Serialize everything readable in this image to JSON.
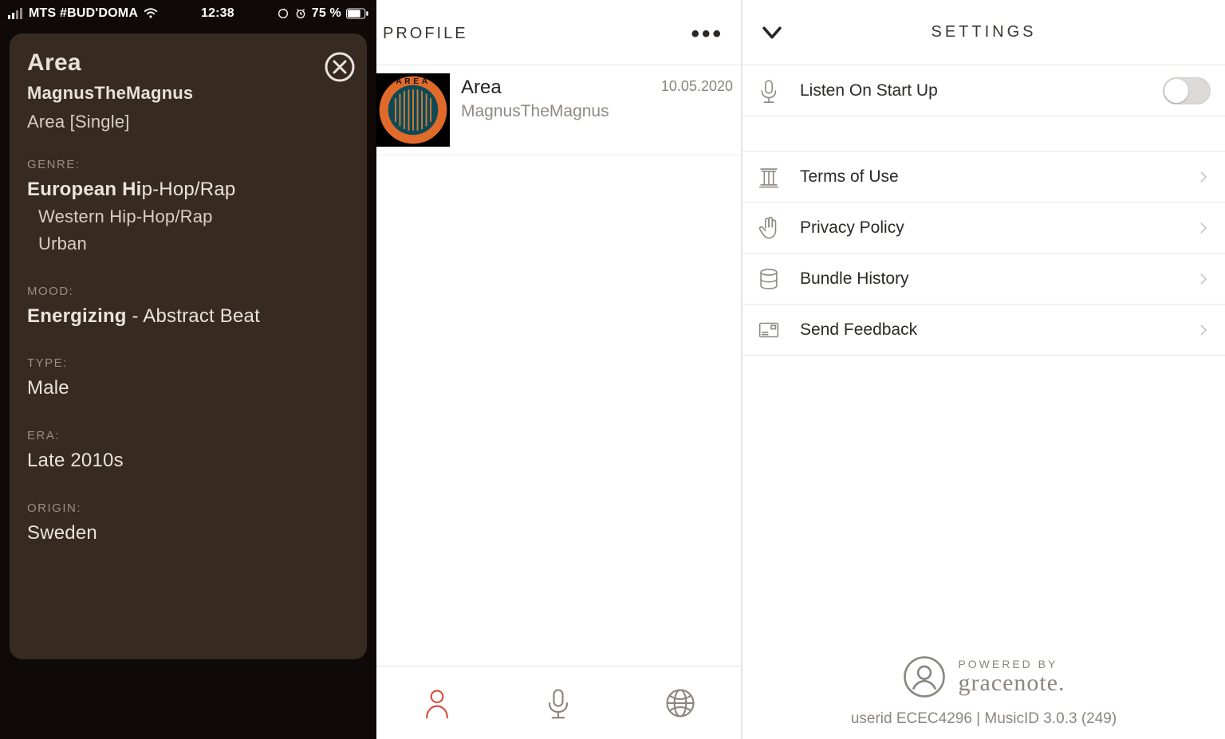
{
  "statusbar": {
    "carrier": "MTS #BUD'DOMA",
    "time": "12:38",
    "battery_text": "75 %"
  },
  "track_card": {
    "title": "Area",
    "artist": "MagnusTheMagnus",
    "album": "Area [Single]",
    "genre_label": "GENRE:",
    "genre_primary_bold": "European Hi",
    "genre_primary_rest": "p-Hop/Rap",
    "genre_secondary_1": "Western Hip-Hop/Rap",
    "genre_secondary_2": "Urban",
    "mood_label": "MOOD:",
    "mood_bold": "Energizing",
    "mood_rest": " - Abstract Beat",
    "type_label": "TYPE:",
    "type_value": "Male",
    "era_label": "ERA:",
    "era_value": "Late 2010s",
    "origin_label": "ORIGIN:",
    "origin_value": "Sweden"
  },
  "mid": {
    "header": "PROFILE",
    "track": "Area",
    "artist": "MagnusTheMagnus",
    "date": "10.05.2020"
  },
  "settings": {
    "header": "SETTINGS",
    "listen_label": "Listen On Start Up",
    "listen_on": false,
    "terms": "Terms of Use",
    "privacy": "Privacy Policy",
    "bundle": "Bundle History",
    "feedback": "Send Feedback",
    "powered_by": "POWERED BY",
    "brand": "gracenote.",
    "meta": "userid ECEC4296 | MusicID 3.0.3 (249)"
  }
}
